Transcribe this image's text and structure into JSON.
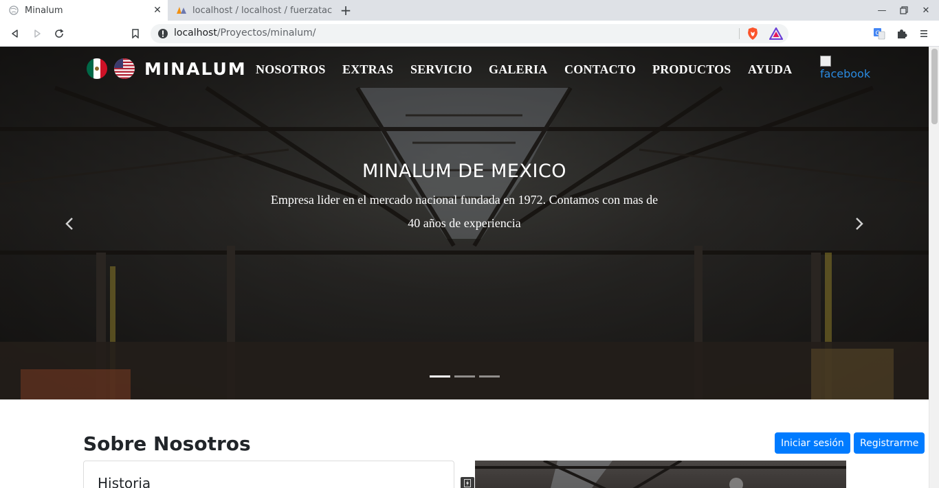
{
  "browser": {
    "tabs": [
      {
        "title": "Minalum",
        "active": true
      },
      {
        "title": "localhost / localhost / fuerzatac",
        "active": false
      }
    ],
    "new_tab_label": "+",
    "url_host": "localhost",
    "url_path": "/Proyectos/minalum/"
  },
  "nav": {
    "brand": "MINALUM",
    "links": [
      "NOSOTROS",
      "EXTRAS",
      "SERVICIO",
      "GALERIA",
      "CONTACTO",
      "PRODUCTOS",
      "AYUDA"
    ],
    "facebook_alt": "facebook"
  },
  "hero": {
    "title": "MINALUM DE MEXICO",
    "text": "Empresa lider en el mercado nacional fundada en 1972. Contamos con mas de 40 años de experiencia",
    "slides": 3,
    "active_slide": 1
  },
  "about": {
    "title": "Sobre Nosotros",
    "login_label": "Iniciar sesión",
    "register_label": "Registrarme",
    "card_title": "Historia"
  },
  "colors": {
    "primary": "#007bff",
    "link": "#2a8ae0"
  }
}
